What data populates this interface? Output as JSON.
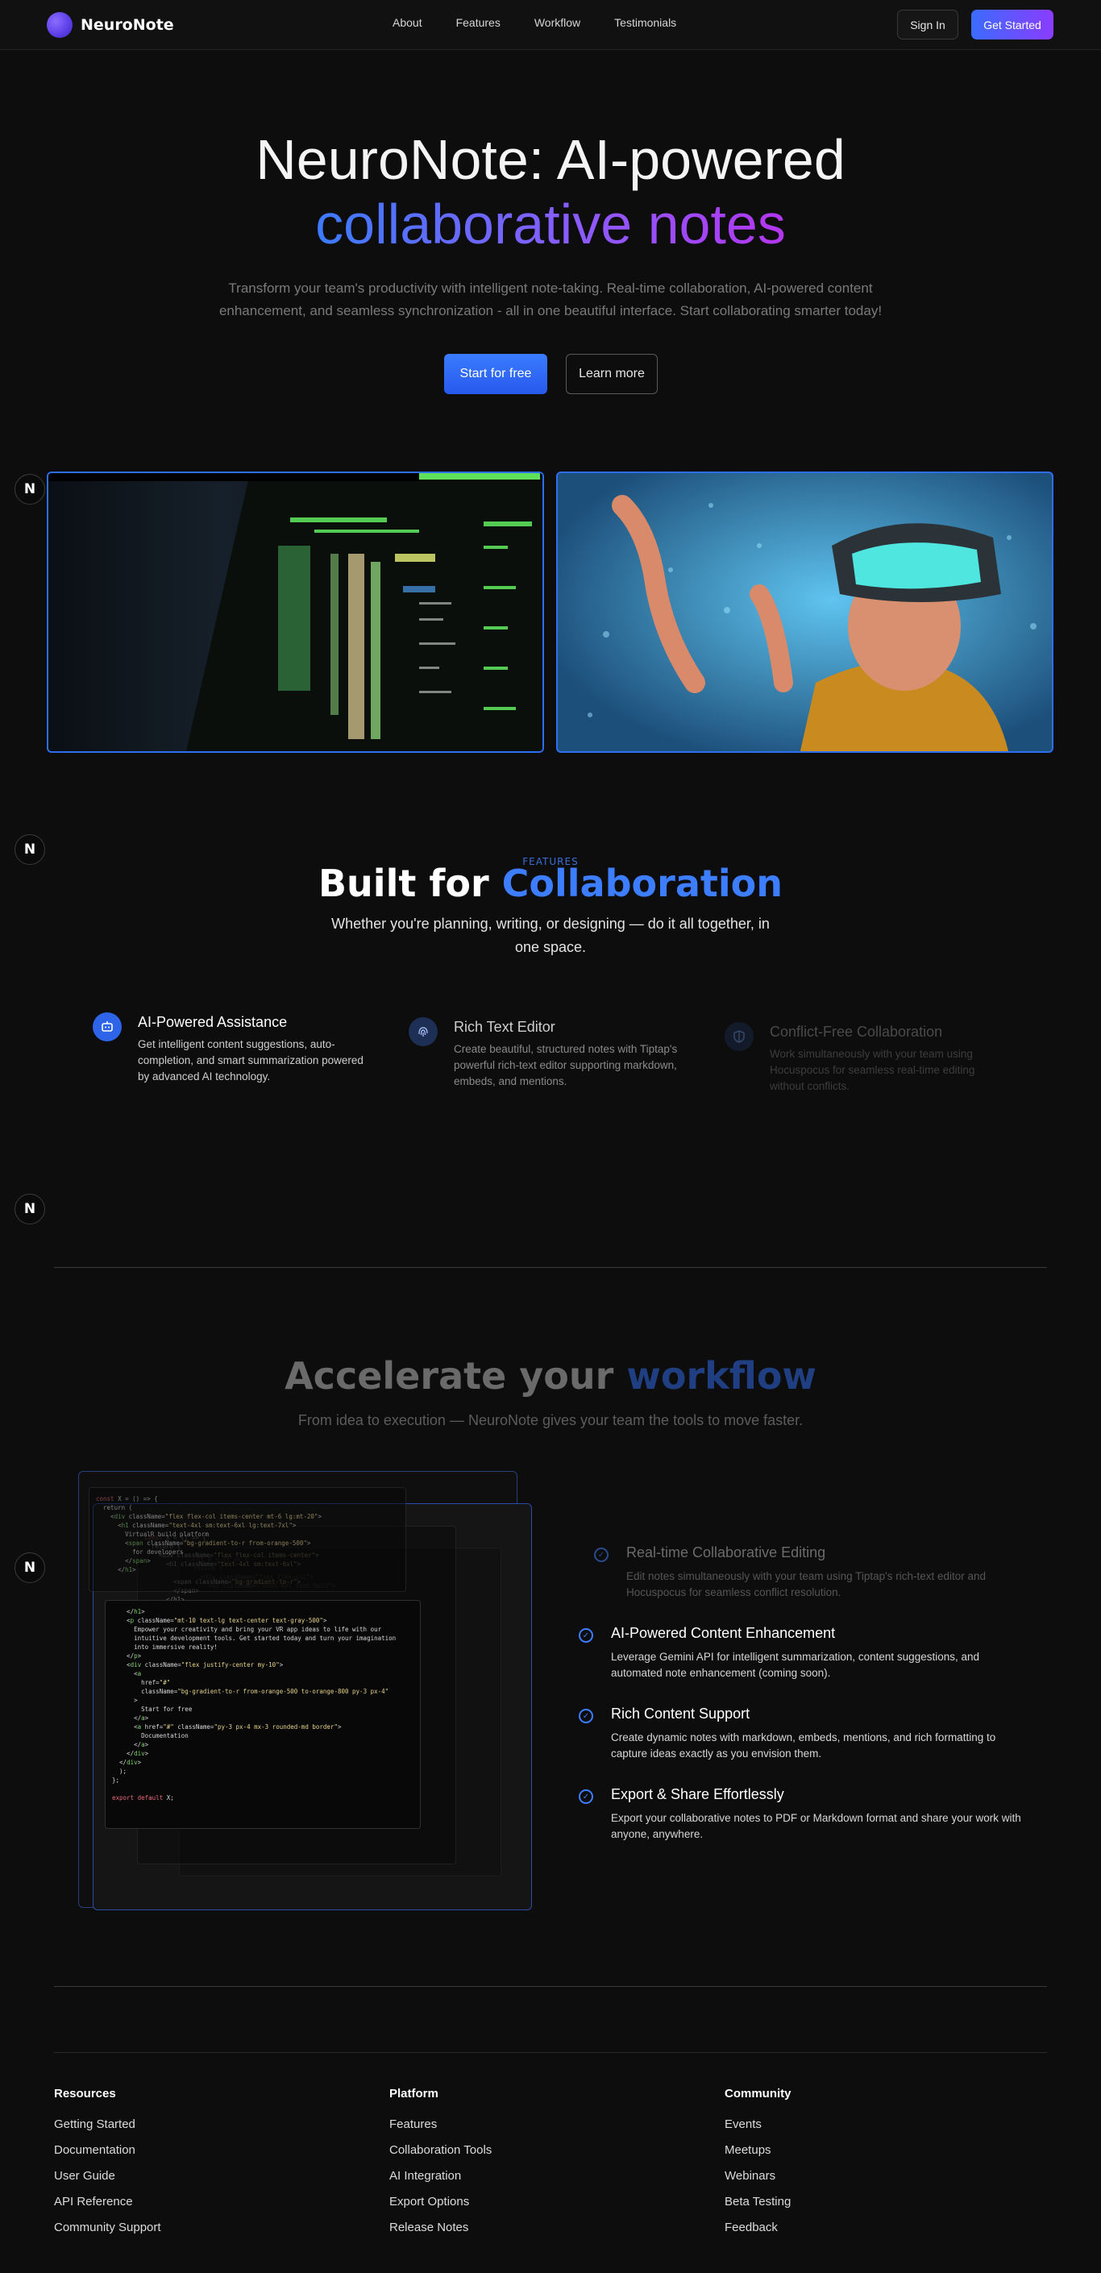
{
  "nav": {
    "brand": "NeuroNote",
    "links": [
      "About",
      "Features",
      "Workflow",
      "Testimonials"
    ],
    "sign_in": "Sign In",
    "get_started": "Get Started"
  },
  "hero": {
    "title_line1": "NeuroNote: AI-powered",
    "title_line2": "collaborative notes",
    "subtitle": "Transform your team's productivity with intelligent note-taking. Real-time collaboration, AI-powered content enhancement, and seamless synchronization - all in one beautiful interface. Start collaborating smarter today!",
    "primary_cta": "Start for free",
    "secondary_cta": "Learn more"
  },
  "side_badge": "N",
  "features": {
    "tag": "FEATURES",
    "title_plain": "Built for ",
    "title_accent": "Collaboration",
    "subtitle": "Whether you're planning, writing, or designing — do it all together, in one space.",
    "items": [
      {
        "title": "AI-Powered Assistance",
        "desc": "Get intelligent content suggestions, auto-completion, and smart summarization powered by advanced AI technology.",
        "icon": "robot-icon"
      },
      {
        "title": "Rich Text Editor",
        "desc": "Create beautiful, structured notes with Tiptap's powerful rich-text editor supporting markdown, embeds, and mentions.",
        "icon": "fingerprint-icon"
      },
      {
        "title": "Conflict-Free Collaboration",
        "desc": "Work simultaneously with your team using Hocuspocus for seamless real-time editing without conflicts.",
        "icon": "shield-icon"
      }
    ]
  },
  "workflow": {
    "title_plain": "Accelerate your ",
    "title_accent": "workflow",
    "subtitle": "From idea to execution — NeuroNote gives your team the tools to move faster.",
    "items": [
      {
        "title": "Real-time Collaborative Editing",
        "desc": "Edit notes simultaneously with your team using Tiptap's rich-text editor and Hocuspocus for seamless conflict resolution."
      },
      {
        "title": "AI-Powered Content Enhancement",
        "desc": "Leverage Gemini API for intelligent summarization, content suggestions, and automated note enhancement (coming soon)."
      },
      {
        "title": "Rich Content Support",
        "desc": "Create dynamic notes with markdown, embeds, mentions, and rich formatting to capture ideas exactly as you envision them."
      },
      {
        "title": "Export & Share Effortlessly",
        "desc": "Export your collaborative notes to PDF or Markdown format and share your work with anyone, anywhere."
      }
    ]
  },
  "footer": {
    "columns": [
      {
        "heading": "Resources",
        "links": [
          "Getting Started",
          "Documentation",
          "User Guide",
          "API Reference",
          "Community Support"
        ]
      },
      {
        "heading": "Platform",
        "links": [
          "Features",
          "Collaboration Tools",
          "AI Integration",
          "Export Options",
          "Release Notes"
        ]
      },
      {
        "heading": "Community",
        "links": [
          "Events",
          "Meetups",
          "Webinars",
          "Beta Testing",
          "Feedback"
        ]
      }
    ]
  },
  "colors": {
    "accent_blue": "#3d7dff",
    "accent_purple": "#8b3cff",
    "background": "#0d0d0d"
  }
}
